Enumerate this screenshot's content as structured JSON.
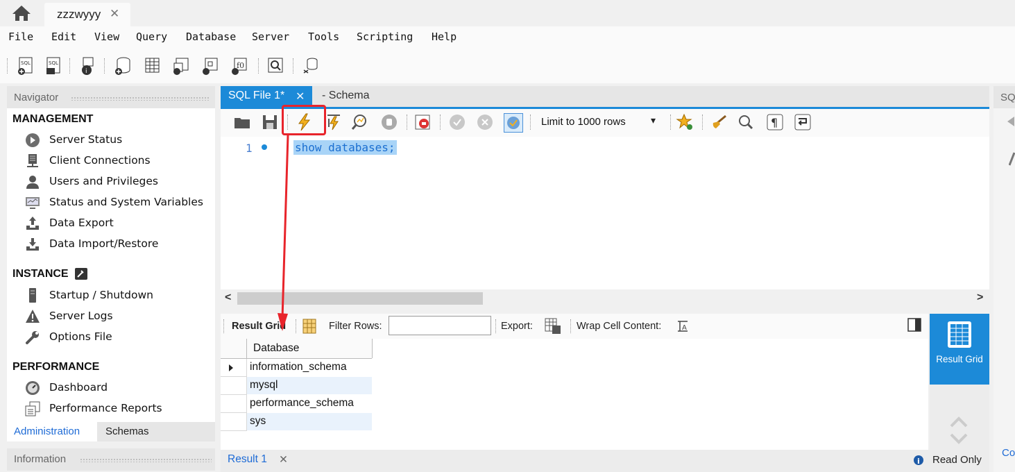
{
  "connection_tab": {
    "label": "zzzwyyy",
    "close": "✕"
  },
  "menu": [
    "File",
    "Edit",
    "View",
    "Query",
    "Database",
    "Server",
    "Tools",
    "Scripting",
    "Help"
  ],
  "navigator": {
    "title": "Navigator",
    "sections": [
      {
        "title": "MANAGEMENT",
        "items": [
          "Server Status",
          "Client Connections",
          "Users and Privileges",
          "Status and System Variables",
          "Data Export",
          "Data Import/Restore"
        ]
      },
      {
        "title": "INSTANCE",
        "items": [
          "Startup / Shutdown",
          "Server Logs",
          "Options File"
        ]
      },
      {
        "title": "PERFORMANCE",
        "items": [
          "Dashboard",
          "Performance Reports"
        ]
      }
    ],
    "tabs": [
      "Administration",
      "Schemas"
    ],
    "info_title": "Information"
  },
  "editor": {
    "tabs": {
      "active": "SQL File 1*",
      "active_close": "✕",
      "other": "- Schema"
    },
    "limit": "Limit to 1000 rows",
    "line_number": "1",
    "code": "show databases;"
  },
  "result": {
    "toolbar": {
      "grid_label": "Result Grid",
      "filter_label": "Filter Rows:",
      "export_label": "Export:",
      "wrap_label": "Wrap Cell Content:"
    },
    "column": "Database",
    "rows": [
      "information_schema",
      "mysql",
      "performance_schema",
      "sys"
    ],
    "side_button": "Result Grid",
    "tab": "Result 1",
    "tab_close": "✕",
    "status": "Read Only"
  },
  "right_panel": {
    "header": "SQ",
    "footer": "Co"
  },
  "colors": {
    "accent": "#1c8ad8",
    "annotation": "#e8242b",
    "selection": "#a9d4f7"
  }
}
